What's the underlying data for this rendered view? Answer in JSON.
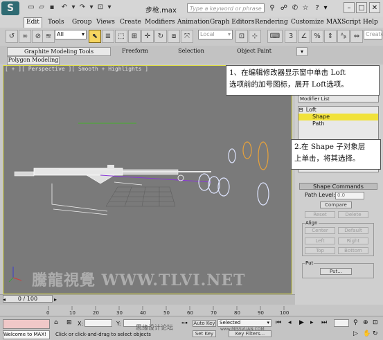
{
  "titlebar": {
    "app_logo": "S",
    "title": "步枪.max",
    "search_placeholder": "Type a keyword or phrase"
  },
  "menubar": {
    "items": [
      "Edit",
      "Tools",
      "Group",
      "Views",
      "Create",
      "Modifiers",
      "Animation",
      "Graph Editors",
      "Rendering",
      "Customize",
      "MAXScript",
      "Help"
    ]
  },
  "toolbar": {
    "selection_filter": "All",
    "coord_system": "Local",
    "named_selection_button": "Create"
  },
  "ribbon": {
    "tabs": [
      "Graphite Modeling Tools",
      "Freeform",
      "Selection",
      "Object Paint"
    ],
    "sub_tab": "Polygon Modeling"
  },
  "viewport": {
    "label": "[ + ][ Perspective ][ Smooth + Highlights ]",
    "watermark": "騰龍視覺 WWW.TLVI.NET"
  },
  "command_panel": {
    "modifier_list": "Modifier List",
    "stack": [
      {
        "label": "Loft",
        "prefix": "⊟",
        "selected": false
      },
      {
        "label": "Shape",
        "prefix": "",
        "selected": true
      },
      {
        "label": "Path",
        "prefix": "",
        "selected": false
      }
    ],
    "rollout_title": "Shape Commands",
    "path_level_label": "Path Level:",
    "path_level_value": "0.0",
    "compare_button": "Compare",
    "reset_button": "Reset",
    "delete_button": "Delete",
    "align_label": "Align",
    "center_button": "Center",
    "default_button": "Default",
    "left_button": "Left",
    "right_button": "Right",
    "top_button": "Top",
    "bottom_button": "Bottom",
    "put_label": "Put",
    "put_button": "Put..."
  },
  "callouts": {
    "first_line1": "1、在编辑修改器显示窗中单击 Loft",
    "first_line2": "选项前的加号图标，展开 Loft选项。",
    "second_line1": "2.在 Shape 子对象层",
    "second_line2": "上单击，将其选择。"
  },
  "timeline": {
    "slider": "0 / 100",
    "ticks": [
      "0",
      "10",
      "20",
      "30",
      "40",
      "50",
      "60",
      "70",
      "80",
      "90",
      "100"
    ]
  },
  "status": {
    "welcome": "Welcome to MAX!",
    "prompt": "Click or click-and-drag to select objects",
    "x_label": "X:",
    "y_label": "Y:",
    "auto_key": "Auto Key",
    "selected": "Selected",
    "set_key": "Set Key",
    "key_filters": "Key Filters...",
    "watermark2": "思缘设计论坛",
    "watermark3": "www.MISSVUAN.COM"
  },
  "colors": {
    "viewport_bg": "#7a7a7a",
    "selection_highlight": "#f1e23a",
    "active_tool": "#f6d560"
  }
}
